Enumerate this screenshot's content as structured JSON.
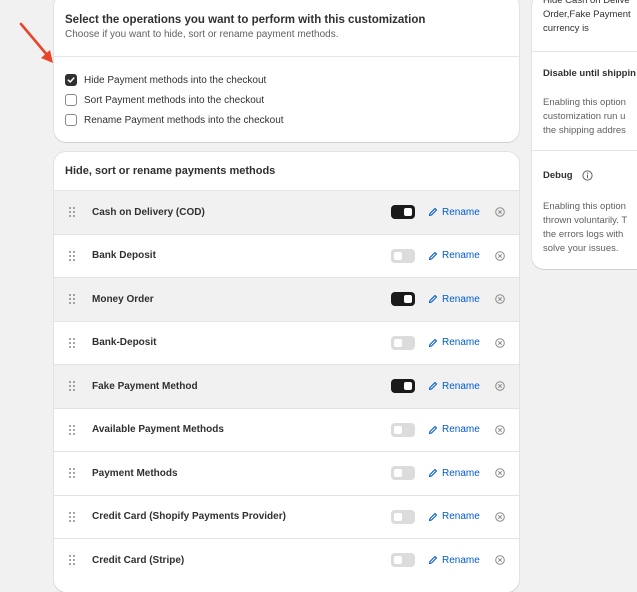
{
  "operations": {
    "title": "Select the operations you want to perform with this customization",
    "subtitle": "Choose if you want to hide, sort or rename payment methods.",
    "options": [
      {
        "label": "Hide Payment methods into the checkout",
        "checked": true
      },
      {
        "label": "Sort Payment methods into the checkout",
        "checked": false
      },
      {
        "label": "Rename Payment methods into the checkout",
        "checked": false
      }
    ]
  },
  "payments": {
    "title": "Hide, sort or rename payments methods",
    "rename_label": "Rename",
    "rows": [
      {
        "name": "Cash on Delivery (COD)",
        "enabled": true
      },
      {
        "name": "Bank Deposit",
        "enabled": false
      },
      {
        "name": "Money Order",
        "enabled": true
      },
      {
        "name": "Bank-Deposit",
        "enabled": false
      },
      {
        "name": "Fake Payment Method",
        "enabled": true
      },
      {
        "name": "Available Payment Methods",
        "enabled": false
      },
      {
        "name": "Payment Methods",
        "enabled": false
      },
      {
        "name": "Credit Card (Shopify Payments Provider)",
        "enabled": false
      },
      {
        "name": "Credit Card (Stripe)",
        "enabled": false
      }
    ]
  },
  "side": {
    "summary_lines": [
      "Hide Cash on Delive",
      "Order,Fake Payment",
      "currency is"
    ],
    "disable_title": "Disable until shippin",
    "disable_lines": [
      "Enabling this option",
      "customization run u",
      "the shipping addres"
    ],
    "debug_title": "Debug",
    "debug_lines": [
      "Enabling this option",
      "thrown voluntarily. T",
      "the errors logs with",
      "solve your issues."
    ]
  },
  "colors": {
    "accent_link": "#005bd3",
    "arrow": "#e8462a",
    "toggle_on": "#1a1a1a",
    "toggle_off": "#dcdcdc"
  }
}
